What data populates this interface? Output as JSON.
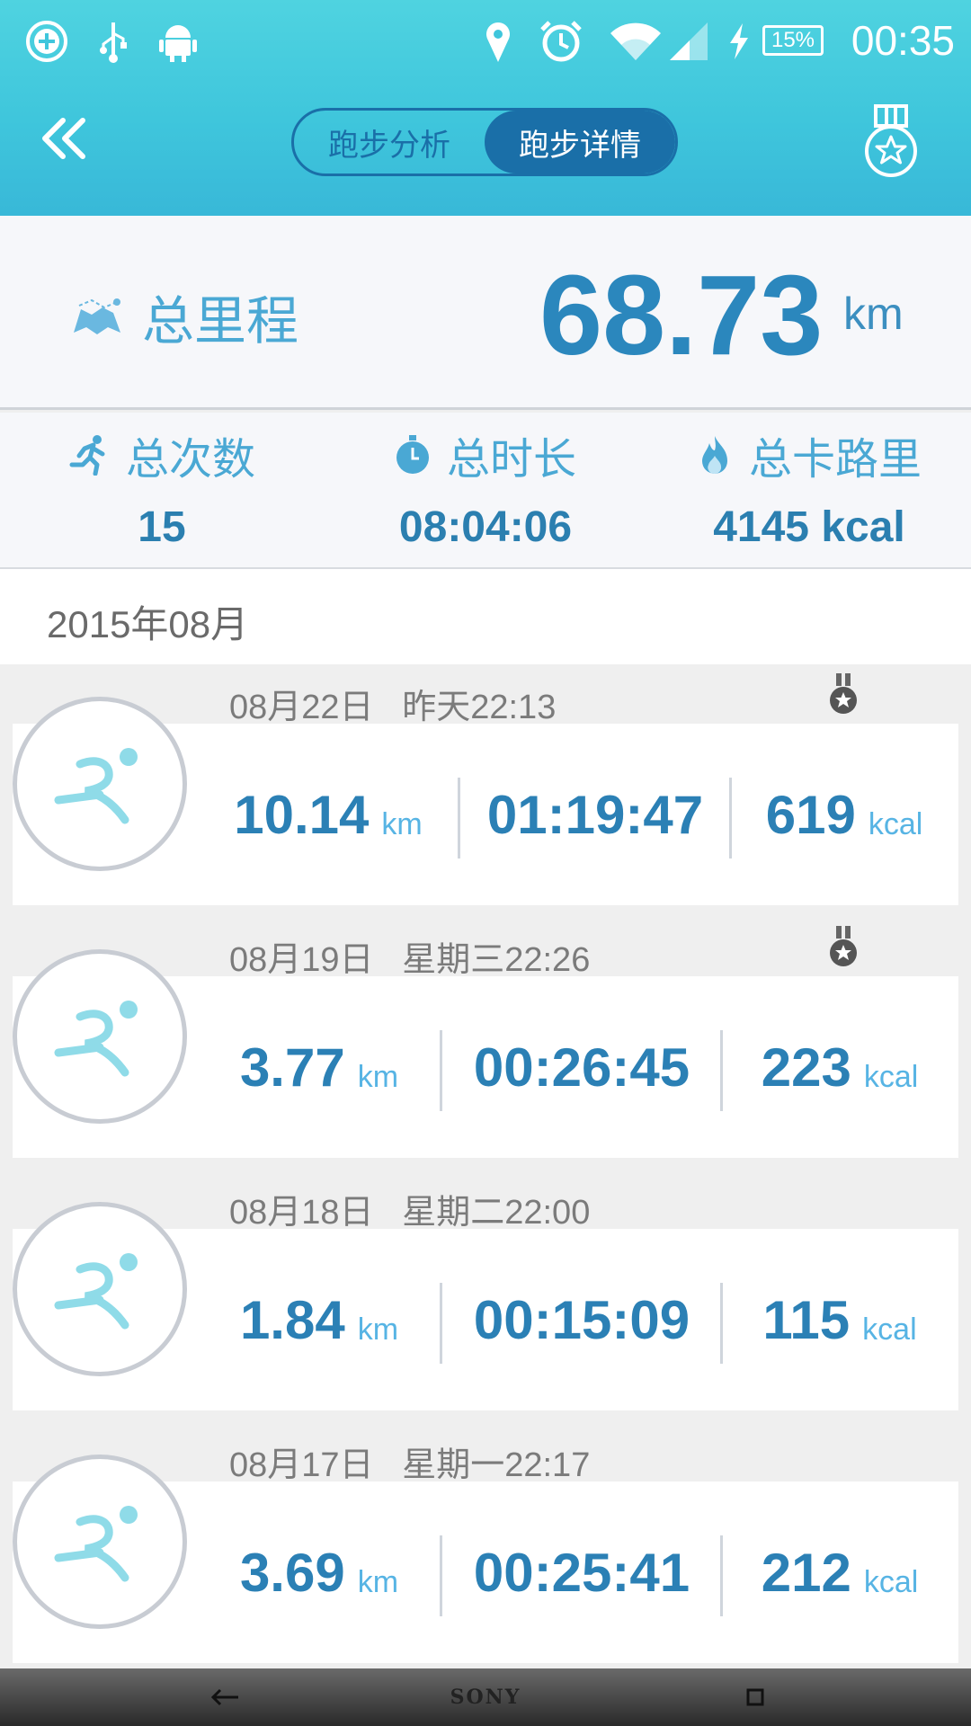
{
  "status_bar": {
    "icons": [
      "add-circle-icon",
      "usb-icon",
      "android-icon",
      "location-pin-icon",
      "alarm-clock-icon",
      "wifi-icon",
      "signal-icon",
      "charging-icon"
    ],
    "battery": "15%",
    "time": "00:35"
  },
  "header": {
    "back_icon": "double-chevron-left-icon",
    "tabs": [
      {
        "label": "跑步分析",
        "active": false
      },
      {
        "label": "跑步详情",
        "active": true
      }
    ],
    "medal_icon": "medal-star-icon"
  },
  "summary": {
    "total_label": "总里程",
    "total_value": "68.73",
    "total_unit": "km",
    "stats": [
      {
        "icon": "running-man-icon",
        "label": "总次数",
        "value": "15"
      },
      {
        "icon": "stopwatch-icon",
        "label": "总时长",
        "value": "08:04:06"
      },
      {
        "icon": "flame-icon",
        "label": "总卡路里",
        "value": "4145 kcal"
      }
    ]
  },
  "month_header": "2015年08月",
  "records": [
    {
      "date": "08月22日",
      "time": "昨天22:13",
      "distance": "10.14",
      "distance_unit": "km",
      "duration": "01:19:47",
      "calories": "619",
      "calories_unit": "kcal",
      "has_medal": true
    },
    {
      "date": "08月19日",
      "time": "星期三22:26",
      "distance": "3.77",
      "distance_unit": "km",
      "duration": "00:26:45",
      "calories": "223",
      "calories_unit": "kcal",
      "has_medal": true
    },
    {
      "date": "08月18日",
      "time": "星期二22:00",
      "distance": "1.84",
      "distance_unit": "km",
      "duration": "00:15:09",
      "calories": "115",
      "calories_unit": "kcal",
      "has_medal": false
    },
    {
      "date": "08月17日",
      "time": "星期一22:17",
      "distance": "3.69",
      "distance_unit": "km",
      "duration": "00:25:41",
      "calories": "212",
      "calories_unit": "kcal",
      "has_medal": false
    }
  ],
  "nav_bar": {
    "back_icon": "nav-back-arrow-icon",
    "brand": "SONY",
    "recents_icon": "nav-recents-icon"
  },
  "colors": {
    "header_top": "#4fd3e0",
    "header_bottom": "#38b8d8",
    "accent_dark": "#1a6fa8",
    "value_blue": "#2b80b5",
    "label_blue": "#4aa8d4"
  }
}
